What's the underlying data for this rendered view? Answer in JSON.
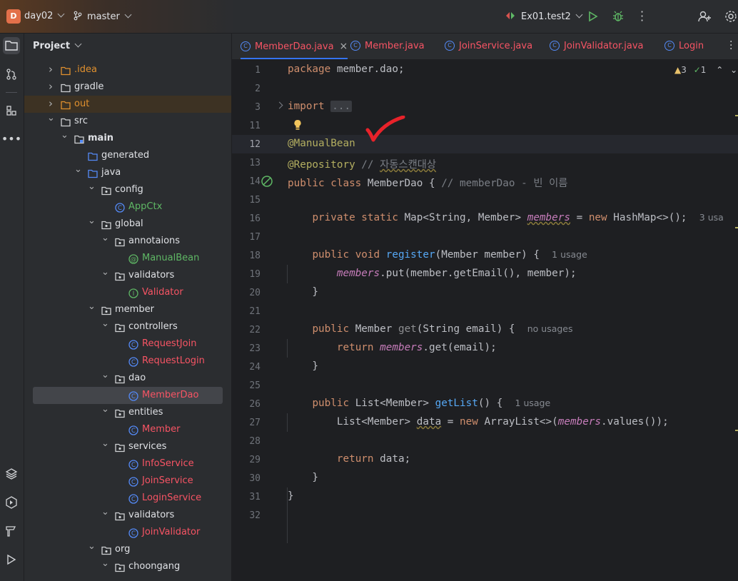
{
  "titlebar": {
    "project_badge": "D",
    "project_name": "day02",
    "branch": "master",
    "run_config": "Ex01.test2"
  },
  "project_panel": {
    "title": "Project",
    "tree": [
      {
        "label": ".idea",
        "depth": 1,
        "kind": "folder",
        "expanded": false,
        "color": "#e0902e"
      },
      {
        "label": "gradle",
        "depth": 1,
        "kind": "folder",
        "expanded": false,
        "color": "#dfe1e5"
      },
      {
        "label": "out",
        "depth": 1,
        "kind": "folder",
        "expanded": false,
        "color": "#e0902e",
        "highlight": true
      },
      {
        "label": "src",
        "depth": 1,
        "kind": "folder",
        "expanded": true,
        "color": "#dfe1e5"
      },
      {
        "label": "main",
        "depth": 2,
        "kind": "module",
        "expanded": true,
        "color": "#dfe1e5",
        "bold": true
      },
      {
        "label": "generated",
        "depth": 3,
        "kind": "src-folder",
        "expanded": null,
        "color": "#dfe1e5"
      },
      {
        "label": "java",
        "depth": 3,
        "kind": "src-folder",
        "expanded": true,
        "color": "#dfe1e5"
      },
      {
        "label": "config",
        "depth": 4,
        "kind": "package",
        "expanded": true,
        "color": "#dfe1e5"
      },
      {
        "label": "AppCtx",
        "depth": 5,
        "kind": "class",
        "expanded": null,
        "color": "#5fb865"
      },
      {
        "label": "global",
        "depth": 4,
        "kind": "package",
        "expanded": true,
        "color": "#dfe1e5"
      },
      {
        "label": "annotaions",
        "depth": 5,
        "kind": "package",
        "expanded": true,
        "color": "#dfe1e5"
      },
      {
        "label": "ManualBean",
        "depth": 6,
        "kind": "annotation",
        "expanded": null,
        "color": "#5fb865"
      },
      {
        "label": "validators",
        "depth": 5,
        "kind": "package",
        "expanded": true,
        "color": "#dfe1e5"
      },
      {
        "label": "Validator",
        "depth": 6,
        "kind": "interface",
        "expanded": null,
        "color": "#f75464"
      },
      {
        "label": "member",
        "depth": 4,
        "kind": "package",
        "expanded": true,
        "color": "#dfe1e5"
      },
      {
        "label": "controllers",
        "depth": 5,
        "kind": "package",
        "expanded": true,
        "color": "#dfe1e5"
      },
      {
        "label": "RequestJoin",
        "depth": 6,
        "kind": "class",
        "expanded": null,
        "color": "#f75464"
      },
      {
        "label": "RequestLogin",
        "depth": 6,
        "kind": "class",
        "expanded": null,
        "color": "#f75464"
      },
      {
        "label": "dao",
        "depth": 5,
        "kind": "package",
        "expanded": true,
        "color": "#dfe1e5"
      },
      {
        "label": "MemberDao",
        "depth": 6,
        "kind": "class",
        "expanded": null,
        "color": "#f75464",
        "selected": true
      },
      {
        "label": "entities",
        "depth": 5,
        "kind": "package",
        "expanded": true,
        "color": "#dfe1e5"
      },
      {
        "label": "Member",
        "depth": 6,
        "kind": "class",
        "expanded": null,
        "color": "#f75464"
      },
      {
        "label": "services",
        "depth": 5,
        "kind": "package",
        "expanded": true,
        "color": "#dfe1e5"
      },
      {
        "label": "InfoService",
        "depth": 6,
        "kind": "class",
        "expanded": null,
        "color": "#f75464"
      },
      {
        "label": "JoinService",
        "depth": 6,
        "kind": "class",
        "expanded": null,
        "color": "#f75464"
      },
      {
        "label": "LoginService",
        "depth": 6,
        "kind": "class",
        "expanded": null,
        "color": "#f75464"
      },
      {
        "label": "validators",
        "depth": 5,
        "kind": "package",
        "expanded": true,
        "color": "#dfe1e5"
      },
      {
        "label": "JoinValidator",
        "depth": 6,
        "kind": "class",
        "expanded": null,
        "color": "#f75464"
      },
      {
        "label": "org",
        "depth": 4,
        "kind": "package",
        "expanded": true,
        "color": "#dfe1e5"
      },
      {
        "label": "choongang",
        "depth": 5,
        "kind": "package",
        "expanded": true,
        "color": "#dfe1e5"
      }
    ]
  },
  "tabs": [
    {
      "label": "MemberDao.java",
      "active": true,
      "color": "#f75464"
    },
    {
      "label": "Member.java",
      "active": false,
      "color": "#f75464"
    },
    {
      "label": "JoinService.java",
      "active": false,
      "color": "#f75464"
    },
    {
      "label": "JoinValidator.java",
      "active": false,
      "color": "#f75464"
    },
    {
      "label": "Login",
      "active": false,
      "color": "#f75464"
    }
  ],
  "editor": {
    "warnings_count": "3",
    "ok_count": "1",
    "line_numbers": [
      "1",
      "2",
      "3",
      "11",
      "12",
      "13",
      "14",
      "15",
      "16",
      "17",
      "18",
      "19",
      "20",
      "21",
      "22",
      "23",
      "24",
      "25",
      "26",
      "27",
      "28",
      "29",
      "30",
      "31",
      "32"
    ],
    "lines": [
      {
        "n": "1",
        "tokens": [
          [
            "kw",
            "package "
          ],
          [
            "",
            "member.dao;"
          ]
        ]
      },
      {
        "n": "2",
        "tokens": []
      },
      {
        "n": "3",
        "tokens": [
          [
            "kw",
            "import "
          ],
          [
            "fold",
            "..."
          ]
        ]
      },
      {
        "n": "11",
        "tokens": []
      },
      {
        "n": "12",
        "tokens": [
          [
            "ann",
            "@ManualBean"
          ]
        ]
      },
      {
        "n": "13",
        "tokens": [
          [
            "ann",
            "@Repository"
          ],
          [
            "cm",
            " // "
          ],
          [
            "cmw",
            "자동스캔대상"
          ]
        ]
      },
      {
        "n": "14",
        "tokens": [
          [
            "kw",
            "public class "
          ],
          [
            "",
            "MemberDao { "
          ],
          [
            "cm",
            "// memberDao - 빈 이름"
          ]
        ]
      },
      {
        "n": "15",
        "tokens": []
      },
      {
        "n": "16",
        "tokens": [
          [
            "",
            "    "
          ],
          [
            "kw",
            "private static "
          ],
          [
            "",
            "Map<String, Member> "
          ],
          [
            "fldw",
            "members"
          ],
          [
            "",
            " = "
          ],
          [
            "kw",
            "new "
          ],
          [
            "",
            "HashMap<>();  "
          ],
          [
            "hint",
            "3 usa"
          ]
        ]
      },
      {
        "n": "17",
        "tokens": []
      },
      {
        "n": "18",
        "tokens": [
          [
            "",
            "    "
          ],
          [
            "kw",
            "public void "
          ],
          [
            "mth",
            "register"
          ],
          [
            "",
            "(Member member) {  "
          ],
          [
            "hint",
            "1 usage"
          ]
        ]
      },
      {
        "n": "19",
        "tokens": [
          [
            "",
            "        "
          ],
          [
            "fld",
            "members"
          ],
          [
            "",
            ".put(member.getEmail(), member);"
          ]
        ]
      },
      {
        "n": "20",
        "tokens": [
          [
            "",
            "    }"
          ]
        ]
      },
      {
        "n": "21",
        "tokens": []
      },
      {
        "n": "22",
        "tokens": [
          [
            "",
            "    "
          ],
          [
            "kw",
            "public "
          ],
          [
            "",
            "Member "
          ],
          [
            "get",
            "get"
          ],
          [
            "",
            "(String email) {  "
          ],
          [
            "hint",
            "no usages"
          ]
        ]
      },
      {
        "n": "23",
        "tokens": [
          [
            "",
            "        "
          ],
          [
            "kw",
            "return "
          ],
          [
            "fld",
            "members"
          ],
          [
            "",
            ".get(email);"
          ]
        ]
      },
      {
        "n": "24",
        "tokens": [
          [
            "",
            "    }"
          ]
        ]
      },
      {
        "n": "25",
        "tokens": []
      },
      {
        "n": "26",
        "tokens": [
          [
            "",
            "    "
          ],
          [
            "kw",
            "public "
          ],
          [
            "",
            "List<Member> "
          ],
          [
            "mth",
            "getList"
          ],
          [
            "",
            "() {  "
          ],
          [
            "hint",
            "1 usage"
          ]
        ]
      },
      {
        "n": "27",
        "tokens": [
          [
            "",
            "        List<Member> "
          ],
          [
            "wav",
            "data"
          ],
          [
            "",
            " = "
          ],
          [
            "kw",
            "new "
          ],
          [
            "",
            "ArrayList<>("
          ],
          [
            "fld",
            "members"
          ],
          [
            "",
            ".values());"
          ]
        ]
      },
      {
        "n": "28",
        "tokens": []
      },
      {
        "n": "29",
        "tokens": [
          [
            "",
            "        "
          ],
          [
            "kw",
            "return "
          ],
          [
            "",
            "data;"
          ]
        ]
      },
      {
        "n": "30",
        "tokens": [
          [
            "",
            "    }"
          ]
        ]
      },
      {
        "n": "31",
        "tokens": [
          [
            "",
            "}"
          ]
        ]
      },
      {
        "n": "32",
        "tokens": []
      }
    ]
  },
  "colors": {
    "accent": "#3574f0",
    "checkmark": "#e8222a"
  }
}
